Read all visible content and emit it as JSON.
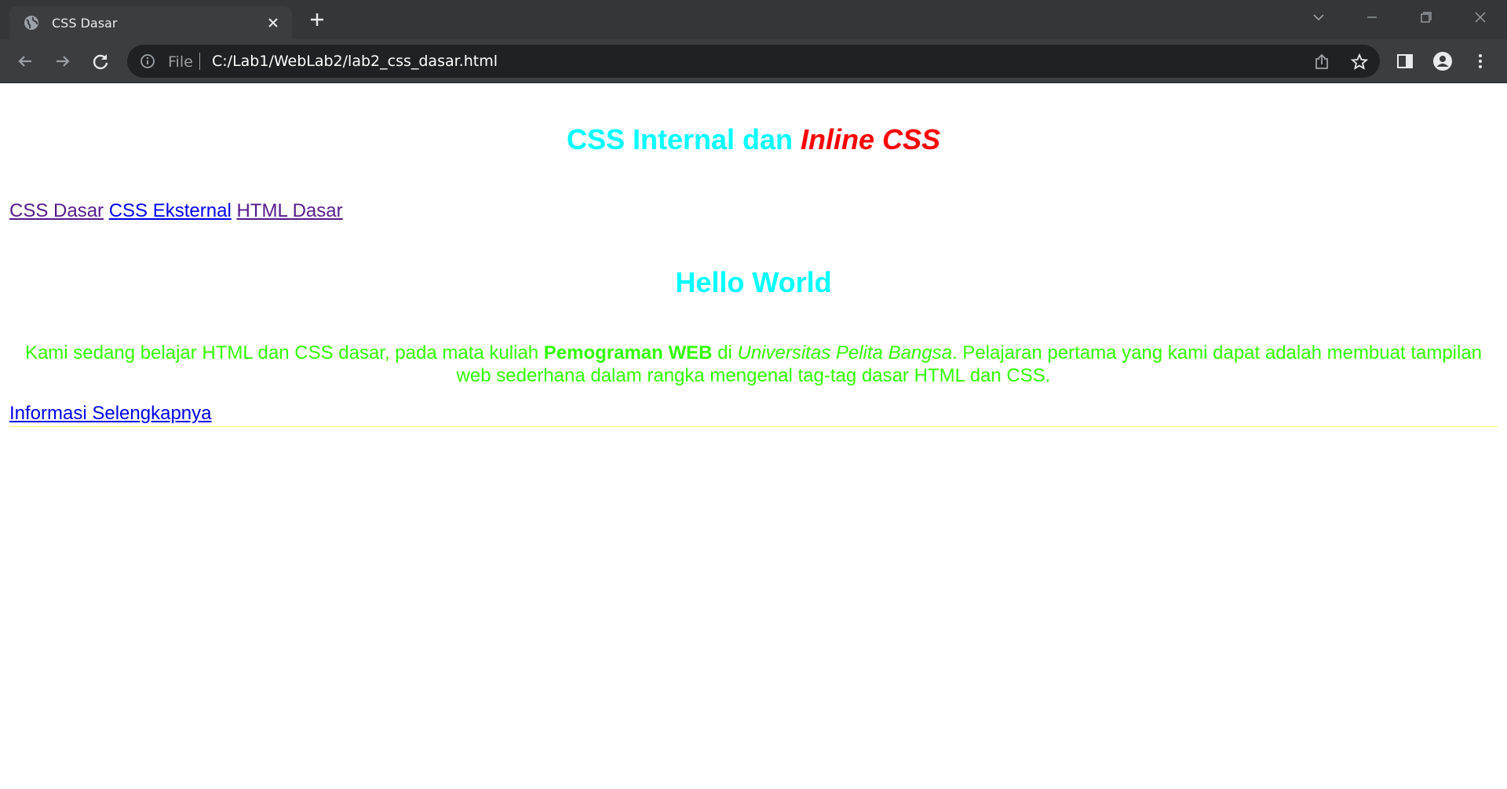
{
  "browser": {
    "tab_title": "CSS Dasar",
    "omnibox": {
      "file_label": "File",
      "url": "C:/Lab1/WebLab2/lab2_css_dasar.html"
    },
    "icons": [
      "globe-icon",
      "close-icon",
      "plus-icon",
      "chevron-down-icon",
      "minimize-icon",
      "restore-icon",
      "window-close-icon",
      "back-arrow-icon",
      "forward-arrow-icon",
      "reload-icon",
      "info-icon",
      "share-icon",
      "star-icon",
      "side-panel-icon",
      "profile-icon",
      "kebab-menu-icon"
    ]
  },
  "page": {
    "heading": {
      "part1": "CSS Internal dan ",
      "part2": "Inline CSS"
    },
    "nav_links": [
      {
        "label": "CSS Dasar",
        "state": "visited"
      },
      {
        "label": "CSS Eksternal",
        "state": "unvisited"
      },
      {
        "label": "HTML Dasar",
        "state": "visited"
      }
    ],
    "subheading": "Hello World",
    "paragraph": {
      "seg1": "Kami sedang belajar HTML dan CSS dasar, pada mata kuliah ",
      "bold": "Pemograman WEB",
      "seg2": " di ",
      "italic": "Universitas Pelita Bangsa",
      "seg3": ". Pelajaran pertama yang kami dapat adalah membuat tampilan web sederhana dalam rangka mengenal tag-tag dasar HTML dan CSS."
    },
    "more_link": "Informasi Selengkapnya"
  },
  "colors": {
    "heading": "#00ffff",
    "heading_inline": "#ff0000",
    "paragraph": "#33ff00",
    "link_visited": "#551a8b",
    "link_unvisited": "#0000ee",
    "rule": "#ffff66"
  }
}
